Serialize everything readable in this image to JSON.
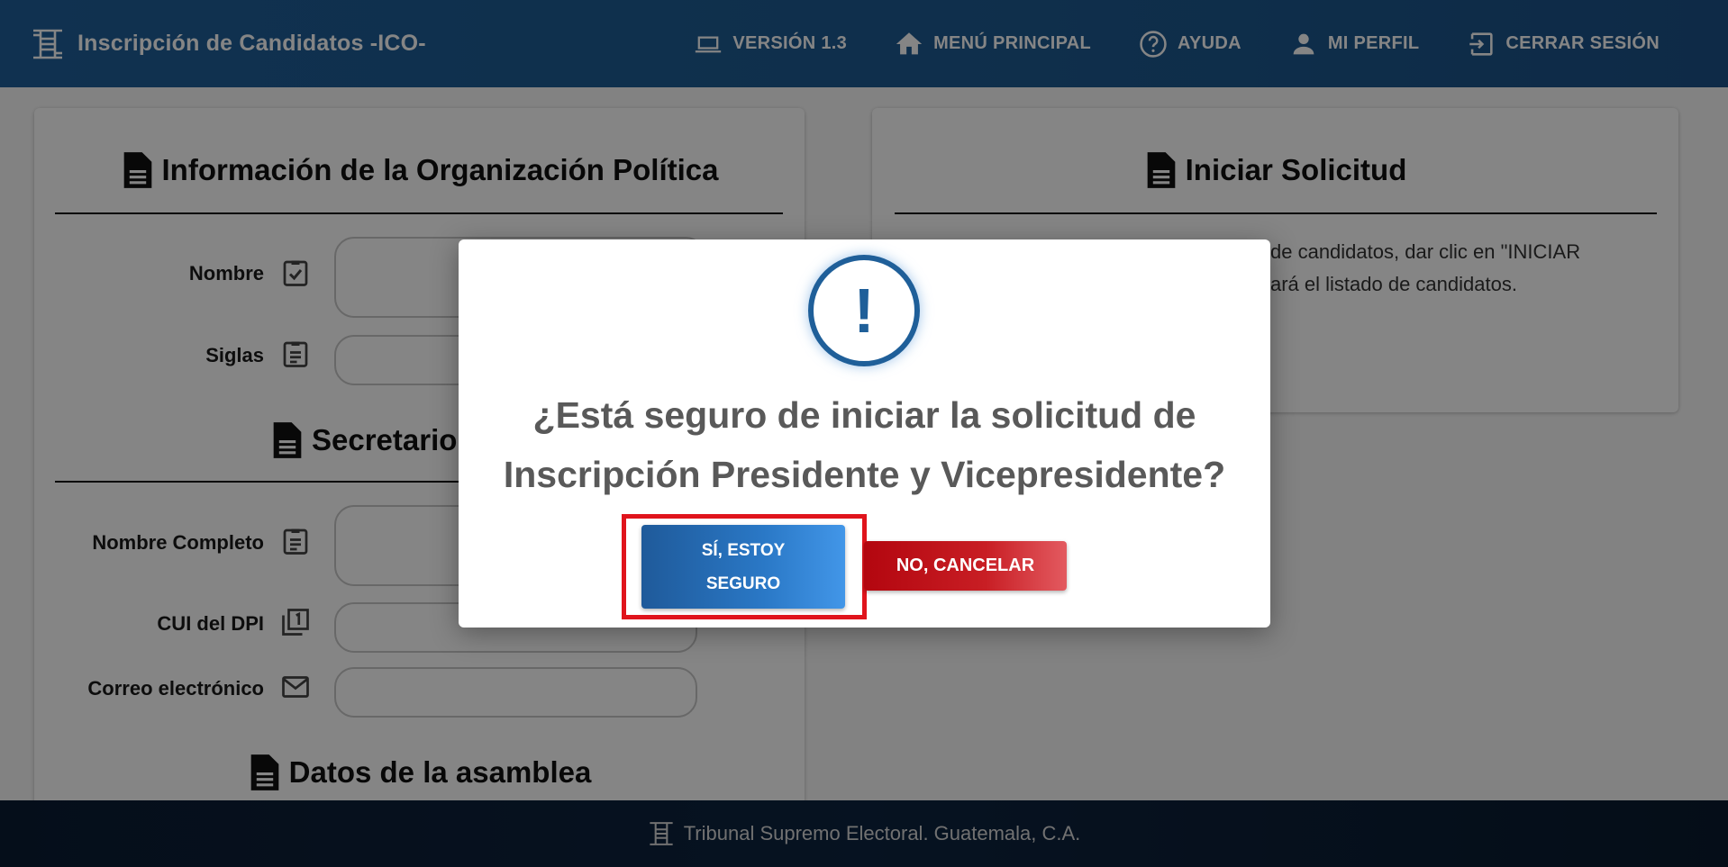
{
  "header": {
    "title": "Inscripción de Candidatos -ICO-",
    "logo_icon": "tse-logo-icon",
    "nav": [
      {
        "label": "VERSIÓN 1.3",
        "icon": "laptop-icon"
      },
      {
        "label": "MENÚ PRINCIPAL",
        "icon": "home-icon"
      },
      {
        "label": "AYUDA",
        "icon": "help-circle-icon"
      },
      {
        "label": "MI PERFIL",
        "icon": "person-icon"
      },
      {
        "label": "CERRAR SESIÓN",
        "icon": "logout-icon"
      }
    ]
  },
  "left_panel": {
    "org_title": "Información de la Organización Política",
    "nombre_label": "Nombre",
    "siglas_label": "Siglas",
    "secretario_title": "Secretario",
    "nombre_completo_label": "Nombre Completo",
    "cui_label": "CUI del DPI",
    "correo_label": "Correo electrónico",
    "asamblea_title": "Datos de la asamblea"
  },
  "right_panel": {
    "title": "Iniciar Solicitud",
    "text_line1": "de candidatos, dar clic en \"INICIAR",
    "text_line2": "ará el listado de candidatos."
  },
  "modal": {
    "icon_glyph": "!",
    "title_line1": "¿Está seguro de iniciar la solicitud de",
    "title_line2": "Inscripción Presidente y Vicepresidente?",
    "confirm_line1": "SÍ, ESTOY",
    "confirm_line2": "SEGURO",
    "cancel_label": "NO, CANCELAR"
  },
  "footer": {
    "text": "Tribunal Supremo Electoral. Guatemala, C.A."
  },
  "colors": {
    "header": "#1f5f99",
    "footer": "#0b1c33",
    "confirm": "#2a78c6",
    "cancel": "#c81e24",
    "highlight": "#e0141c"
  }
}
